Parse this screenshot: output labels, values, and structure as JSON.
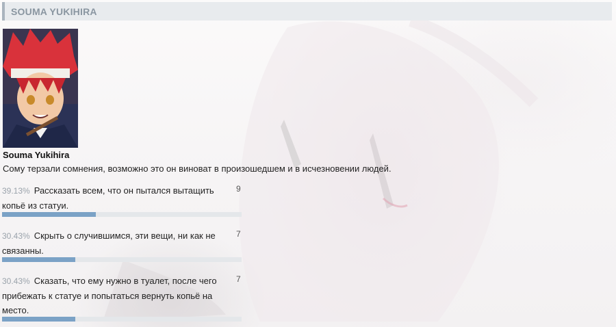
{
  "header": {
    "title": "SOUMA YUKIHIRA"
  },
  "character": {
    "name": "Souma Yukihira",
    "description": "Сому терзали сомнения, возможно это он виноват в произошедшем и в исчезновении людей."
  },
  "poll": {
    "options": [
      {
        "percent": "39.13%",
        "text": "Рассказать всем, что он пытался вытащить копьё из статуи.",
        "count": "9",
        "fraction": 0.3913
      },
      {
        "percent": "30.43%",
        "text": "Скрыть о случившимся, эти вещи, ни как не связанны.",
        "count": "7",
        "fraction": 0.3043
      },
      {
        "percent": "30.43%",
        "text": "Сказать, что ему нужно в туалет, после чего прибежать к статуе и попытаться вернуть копьё на место.",
        "count": "7",
        "fraction": 0.3043
      }
    ]
  },
  "colors": {
    "bar_fill": "#7ba2c6",
    "bar_track": "#e4e7ea",
    "title_text": "#8a96a1"
  }
}
